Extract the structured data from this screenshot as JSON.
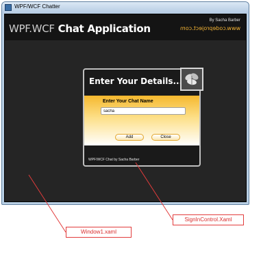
{
  "window": {
    "title": "WPF/WCF Chatter"
  },
  "header": {
    "title_prefix": "WPF.WCF",
    "title_main": "Chat Application",
    "byline": "By Sacha Barber",
    "url": "www.codeproject.com"
  },
  "signin": {
    "heading": "Enter Your Details......",
    "field_label": "Enter Your Chat Name",
    "name_value": "sacha",
    "add_label": "Add",
    "close_label": "Close",
    "footer": "WPF/WCF Chat by Sacha Barber",
    "badge_icon": "leaf-icon"
  },
  "callouts": {
    "window_label": "Window1.xaml",
    "signin_label": "SignInControl.Xaml",
    "color": "#e23b3b"
  },
  "colors": {
    "accent": "#f5b82e",
    "background": "#252525"
  }
}
